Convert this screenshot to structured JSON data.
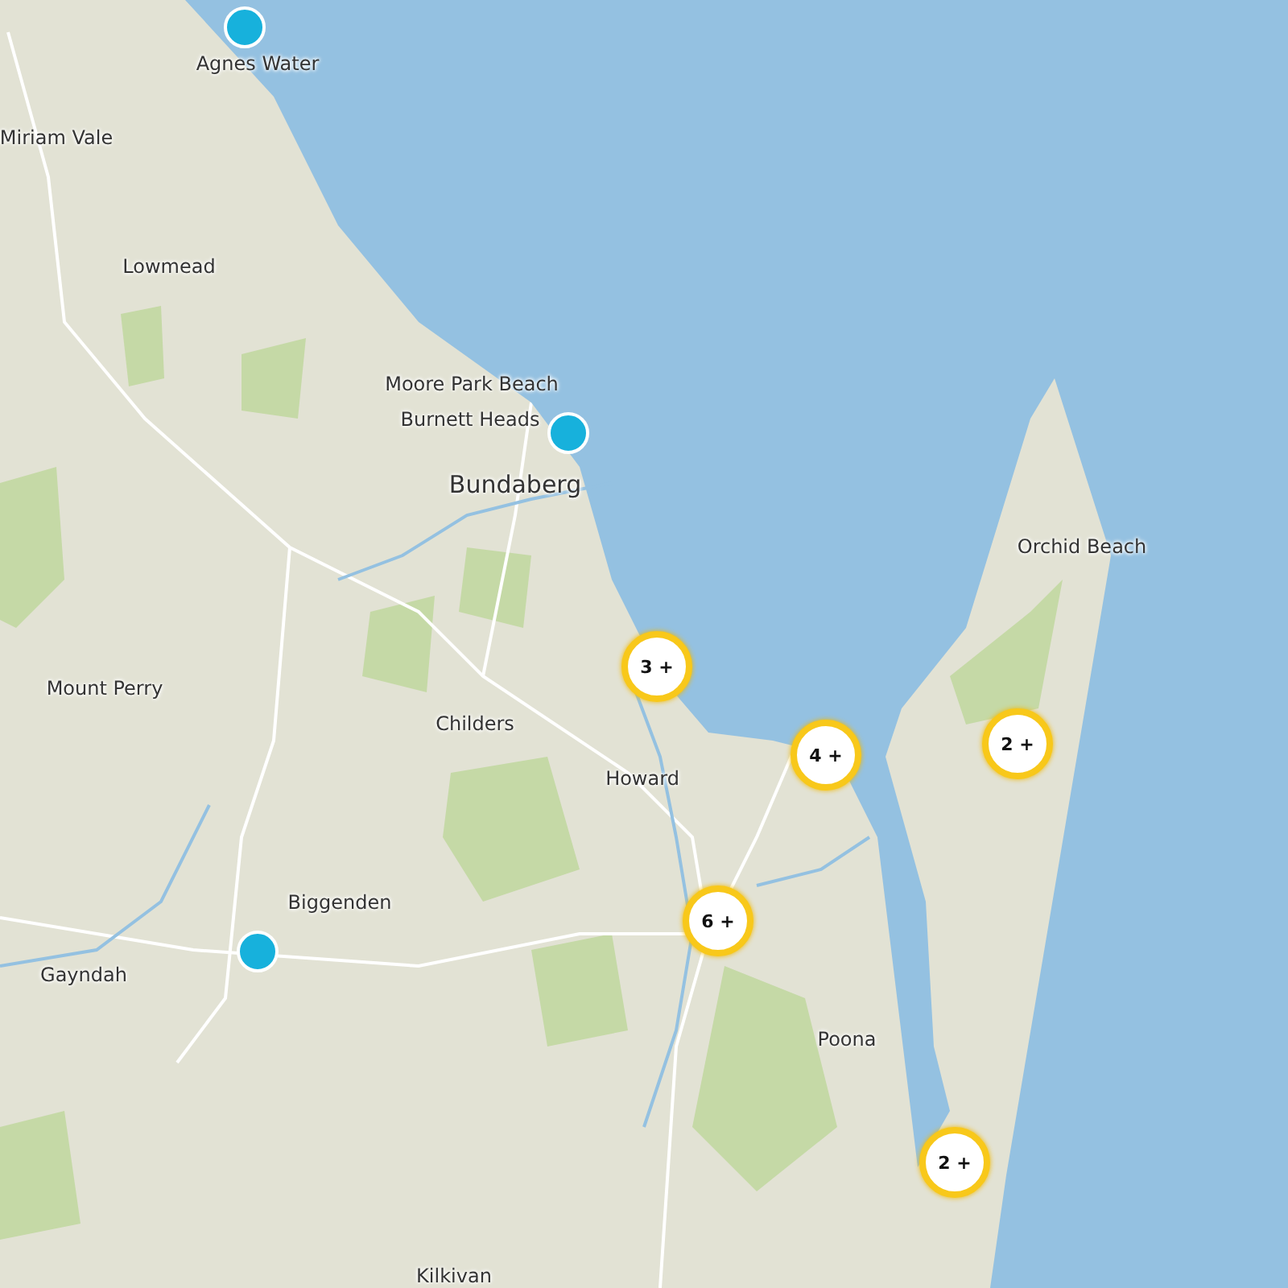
{
  "map": {
    "places": [
      {
        "label": "Agnes Water"
      },
      {
        "label": "Miriam Vale"
      },
      {
        "label": "Lowmead"
      },
      {
        "label": "Moore Park Beach"
      },
      {
        "label": "Burnett Heads"
      },
      {
        "label": "Bundaberg"
      },
      {
        "label": "Orchid Beach"
      },
      {
        "label": "Mount Perry"
      },
      {
        "label": "Childers"
      },
      {
        "label": "Howard"
      },
      {
        "label": "Biggenden"
      },
      {
        "label": "Gayndah"
      },
      {
        "label": "Poona"
      },
      {
        "label": "Kilkivan"
      }
    ],
    "markers": [
      {
        "kind": "point"
      },
      {
        "kind": "point"
      },
      {
        "kind": "point"
      },
      {
        "kind": "cluster",
        "count": "3 +"
      },
      {
        "kind": "cluster",
        "count": "4 +"
      },
      {
        "kind": "cluster",
        "count": "2 +"
      },
      {
        "kind": "cluster",
        "count": "6 +"
      },
      {
        "kind": "cluster",
        "count": "2 +"
      }
    ]
  }
}
